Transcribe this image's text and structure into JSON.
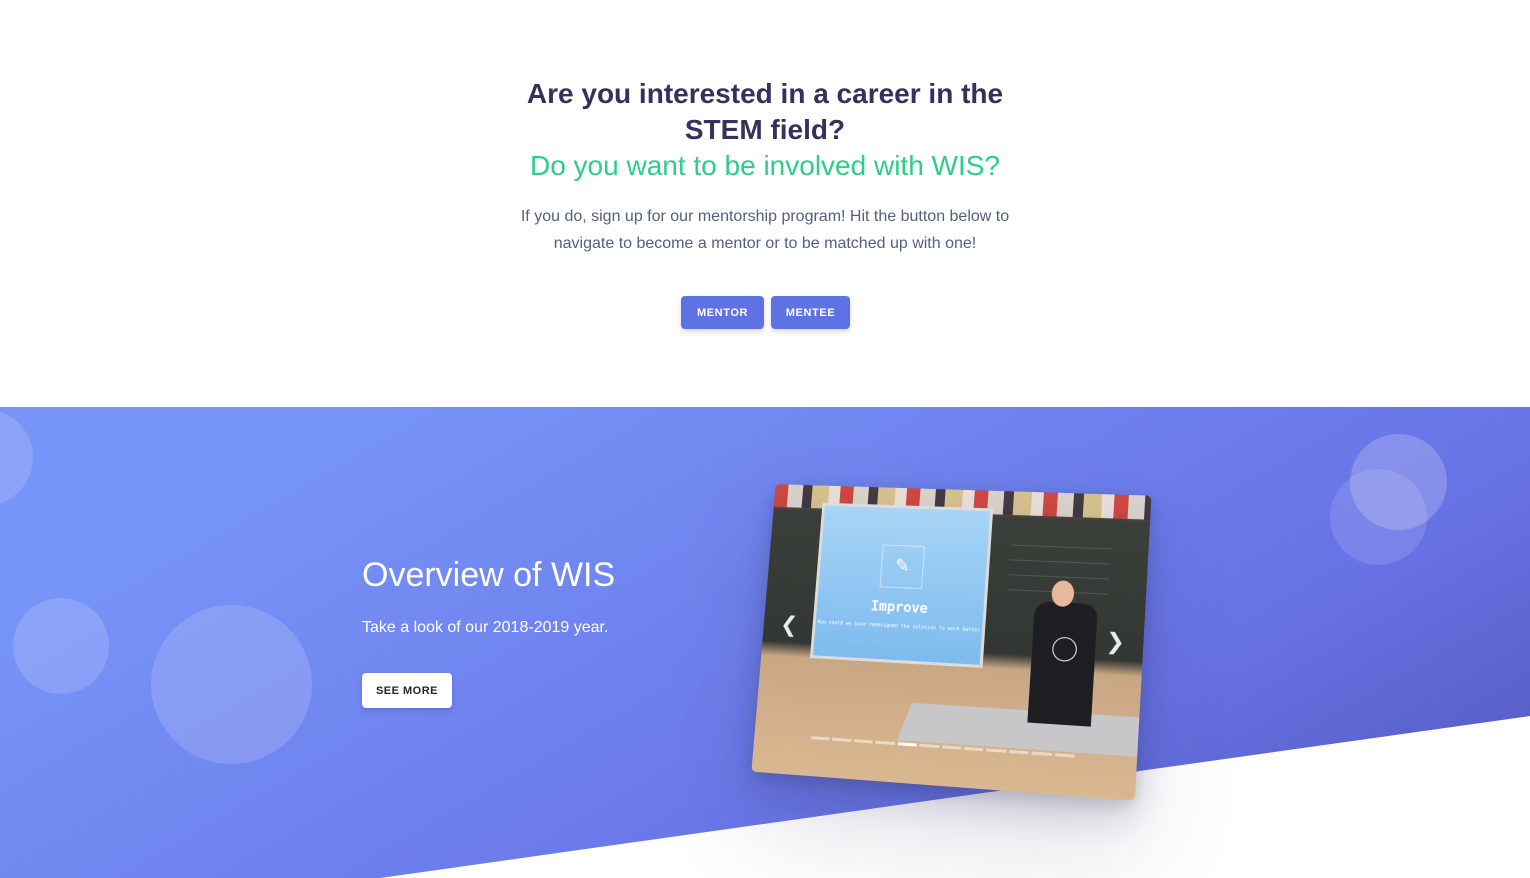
{
  "cta": {
    "title_line1": "Are you interested in a career in the",
    "title_line2": "STEM field?",
    "subtitle": "Do you want to be involved with WIS?",
    "description": "If you do, sign up for our mentorship program! Hit the button below to navigate to become a mentor or to be matched up with one!",
    "mentor_label": "MENTOR",
    "mentee_label": "MENTEE"
  },
  "hero": {
    "title": "Overview of WIS",
    "lead": "Take a look of our 2018-2019 year.",
    "see_more_label": "SEE MORE"
  },
  "carousel": {
    "slide_heading": "Improve",
    "slide_caption": "How could we have redesigned the solution to work better",
    "prev_icon": "chevron-left-icon",
    "next_icon": "chevron-right-icon",
    "indicator_count": 12,
    "active_indicator": 4
  },
  "colors": {
    "heading": "#32325d",
    "accent_green": "#2dce89",
    "primary": "#5e72e4",
    "text_muted": "#525f7f"
  }
}
